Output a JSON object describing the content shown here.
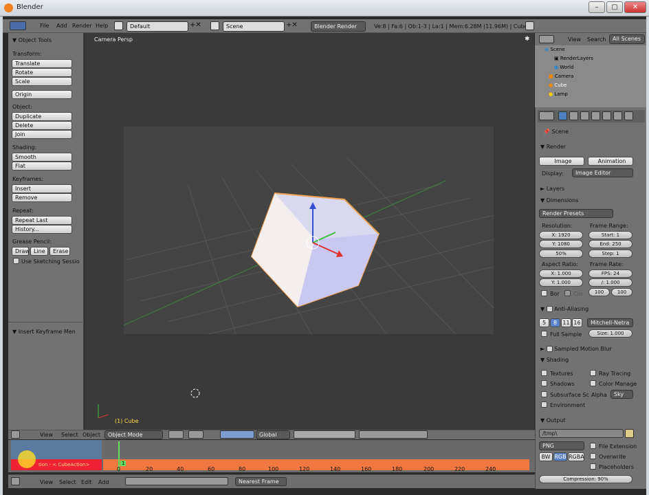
{
  "window": {
    "title": "Blender",
    "min": "–",
    "max": "▢",
    "close": "✕"
  },
  "menu": {
    "file": "File",
    "add": "Add",
    "render": "Render",
    "help": "Help",
    "layout": "Default",
    "scene": "Scene",
    "engine": "Blender Render",
    "stats": "Ve:8 | Fa:6 | Ob:1-3 | La:1 | Mem:6.28M (11.96M) | Cube"
  },
  "toolshelf": {
    "title": "Object Tools",
    "transform": "Transform:",
    "translate": "Translate",
    "rotate": "Rotate",
    "scale": "Scale",
    "origin": "Origin",
    "object": "Object:",
    "duplicate": "Duplicate",
    "delete": "Delete",
    "join": "Join",
    "shading": "Shading:",
    "smooth": "Smooth",
    "flat": "Flat",
    "keyframes": "Keyframes:",
    "insert": "Insert",
    "remove": "Remove",
    "repeat": "Repeat:",
    "repeat_last": "Repeat Last",
    "history": "History...",
    "grease": "Grease Pencil:",
    "draw": "Draw",
    "line": "Line",
    "erase": "Erase",
    "sketch": "Use Sketching Sessio",
    "insert_kf_menu": "Insert Keyframe Men"
  },
  "viewport": {
    "label": "Camera Persp",
    "object_name": "(1) Cube"
  },
  "outliner": {
    "view": "View",
    "search": "Search",
    "all_scenes": "All Scenes",
    "items": [
      "Scene",
      "RenderLayers",
      "World",
      "Camera",
      "Cube",
      "Lamp"
    ]
  },
  "properties": {
    "scene": "Scene",
    "render": "Render",
    "image": "Image",
    "animation": "Animation",
    "display": "Display:",
    "display_val": "Image Editor",
    "layers": "Layers",
    "dimensions": "Dimensions",
    "presets": "Render Presets",
    "resolution": "Resolution:",
    "x": "X: 1920",
    "y": "Y: 1080",
    "percent": "50%",
    "frame_range": "Frame Range:",
    "start": "Start: 1",
    "end": "End: 250",
    "step": "Step: 1",
    "aspect": "Aspect Ratio:",
    "ax": "X: 1.000",
    "ay": "Y: 1.000",
    "frame_rate": "Frame Rate:",
    "fps": "FPS: 24",
    "fbase": "/: 1.000",
    "bor": "Bor",
    "cro": "Cro",
    "old": "100",
    "new": "100",
    "aa": "Anti-Aliasing",
    "aa_samples": [
      "5",
      "8",
      "11",
      "16"
    ],
    "filter": "Mitchell-Netra",
    "full_sample": "Full Sample",
    "size": "Size: 1.000",
    "motion_blur": "Sampled Motion Blur",
    "shading": "Shading",
    "textures": "Textures",
    "ray_tracing": "Ray Tracing",
    "shadows": "Shadows",
    "color_manage": "Color Manage",
    "sss": "Subsurface Sc",
    "alpha": "Alpha",
    "alpha_val": "Sky",
    "environment": "Environment",
    "output": "Output",
    "path": "/tmp\\",
    "format": "PNG",
    "file_ext": "File Extension",
    "overwrite": "Overwrite",
    "placeholders": "Placeholders",
    "bw": "BW",
    "rgb": "RGB",
    "rgba": "RGBA",
    "compression": "Compression: 90%"
  },
  "header3d": {
    "view": "View",
    "select": "Select",
    "object": "Object",
    "mode": "Object Mode",
    "orientation": "Global"
  },
  "timeline": {
    "action": "tion - < CubeAction>",
    "current": "1",
    "ticks": [
      "0",
      "20",
      "40",
      "60",
      "80",
      "100",
      "120",
      "140",
      "160",
      "180",
      "200",
      "220",
      "240"
    ],
    "view": "View",
    "select": "Select",
    "edit": "Edit",
    "add": "Add",
    "keying": "Nearest Frame"
  }
}
